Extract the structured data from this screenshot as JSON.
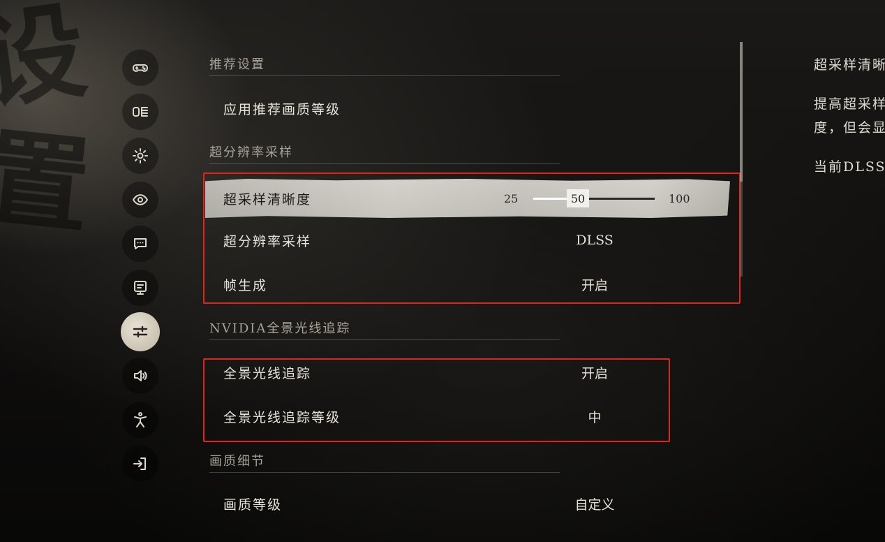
{
  "sidebar": {
    "items": [
      {
        "icon": "gamepad-icon",
        "active": false
      },
      {
        "icon": "display-mode-icon",
        "active": false
      },
      {
        "icon": "settings-gear-icon",
        "active": false
      },
      {
        "icon": "eye-icon",
        "active": false
      },
      {
        "icon": "chat-bubble-icon",
        "active": false
      },
      {
        "icon": "monitor-icon",
        "active": false
      },
      {
        "icon": "sliders-icon",
        "active": true
      },
      {
        "icon": "audio-icon",
        "active": false
      },
      {
        "icon": "accessibility-icon",
        "active": false
      },
      {
        "icon": "exit-icon",
        "active": false
      }
    ]
  },
  "sections": {
    "recommended": {
      "title": "推荐设置",
      "apply_label": "应用推荐画质等级"
    },
    "super_resolution": {
      "title": "超分辨率采样",
      "sharpness_label": "超采样清晰度",
      "sharpness_min": "25",
      "sharpness_value": "50",
      "sharpness_max": "100",
      "sharpness_fraction": 0.333,
      "upscaling_label": "超分辨率采样",
      "upscaling_value": "DLSS",
      "framegen_label": "帧生成",
      "framegen_value": "开启"
    },
    "raytracing": {
      "title": "NVIDIA全景光线追踪",
      "rt_label": "全景光线追踪",
      "rt_value": "开启",
      "rt_level_label": "全景光线追踪等级",
      "rt_level_value": "中"
    },
    "quality": {
      "title": "画质细节",
      "level_label": "画质等级",
      "level_value": "自定义"
    }
  },
  "description": {
    "title": "超采样清晰度",
    "line1": "提高超采样清晰",
    "line2": "度，但会显",
    "line3": "当前DLSS"
  },
  "colors": {
    "highlight_box": "#e0261c",
    "accent": "#d3d0ca"
  }
}
